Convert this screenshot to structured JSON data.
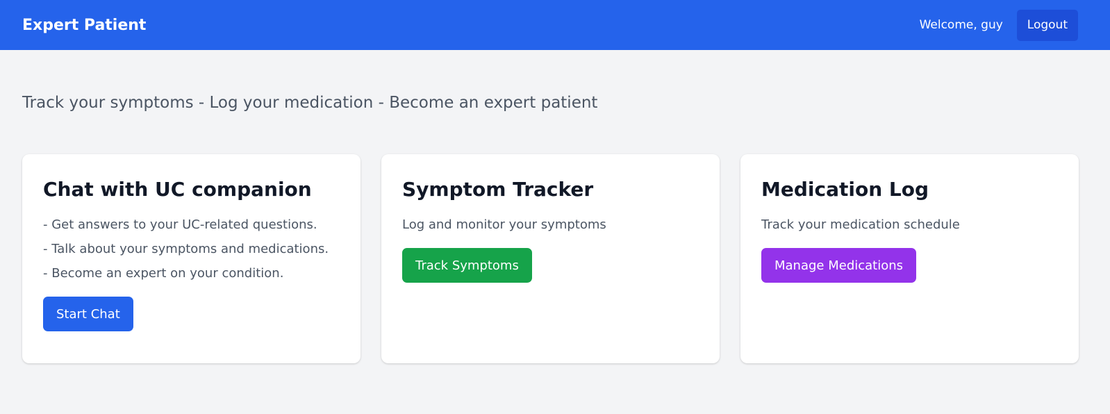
{
  "header": {
    "brand": "Expert Patient",
    "welcome": "Welcome, guy",
    "logout_label": "Logout"
  },
  "tagline": "Track your symptoms - Log your medication - Become an expert patient",
  "cards": [
    {
      "title": "Chat with UC companion",
      "lines": [
        "- Get answers to your UC-related questions.",
        "- Talk about your symptoms and medications.",
        "- Become an expert on your condition."
      ],
      "button_label": "Start Chat",
      "button_color": "#2563eb"
    },
    {
      "title": "Symptom Tracker",
      "lines": [
        "Log and monitor your symptoms"
      ],
      "button_label": "Track Symptoms",
      "button_color": "#16a34a"
    },
    {
      "title": "Medication Log",
      "lines": [
        "Track your medication schedule"
      ],
      "button_label": "Manage Medications",
      "button_color": "#9333ea"
    }
  ],
  "colors": {
    "navbar": "#2563eb",
    "logout_button": "#1d4ed8",
    "background": "#f3f4f6"
  }
}
